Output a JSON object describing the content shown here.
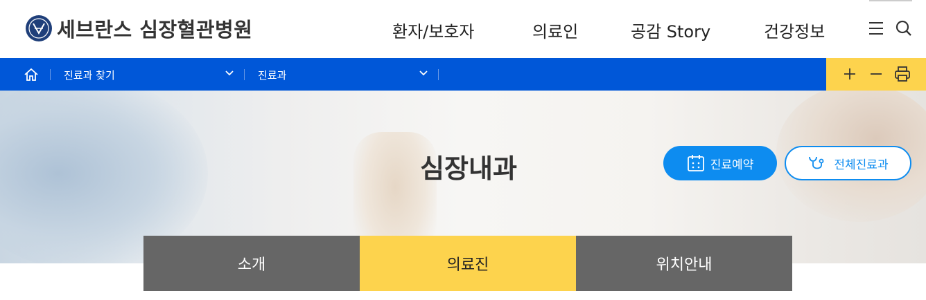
{
  "header": {
    "logo_text": "세브란스 심장혈관병원",
    "nav": [
      "환자/보호자",
      "의료인",
      "공감 Story",
      "건강정보"
    ],
    "icons": [
      "menu-icon",
      "search-icon"
    ]
  },
  "locbar": {
    "home_icon": "home-icon",
    "crumb1": "진료과 찾기",
    "crumb2": "진료과",
    "tools": [
      "zoom-in-icon",
      "zoom-out-icon",
      "print-icon"
    ],
    "bar_color": "#0057d8",
    "tools_color": "#fdd34d"
  },
  "hero": {
    "title": "심장내과",
    "reserve_label": "진료예약",
    "all_departments_label": "전체진료과",
    "accent": "#0d8cf0"
  },
  "tabs": [
    {
      "label": "소개",
      "active": false
    },
    {
      "label": "의료진",
      "active": true
    },
    {
      "label": "위치안내",
      "active": false
    }
  ]
}
